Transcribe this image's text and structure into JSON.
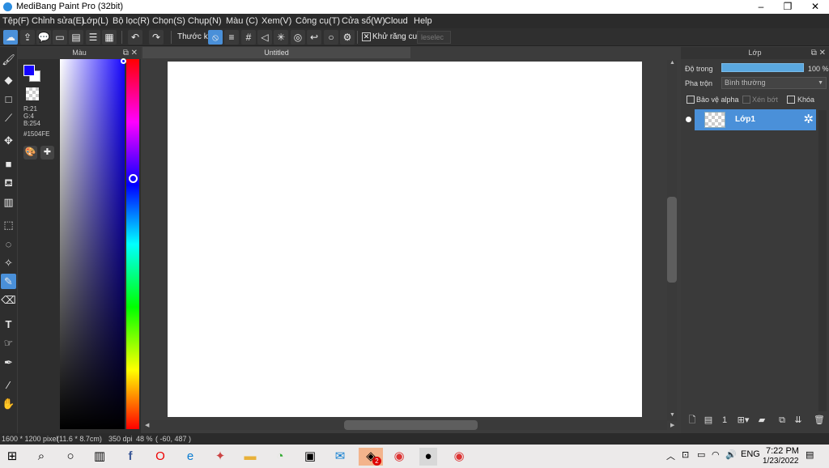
{
  "window": {
    "title": "MediBang Paint Pro (32bit)",
    "controls": [
      "–",
      "❐",
      "✕"
    ]
  },
  "menu": [
    "Tệp(F)",
    "Chỉnh sửa(E)",
    "Lớp(L)",
    "Bộ lọc(R)",
    "Chọn(S)",
    "Chụp(N)",
    "Màu (C)",
    "Xem(V)",
    "Công cụ(T)",
    "Cửa sổ(W)",
    "Cloud",
    "Help"
  ],
  "toolbar": {
    "ruler_label": "Thước kẻ",
    "antialias_label": "Khử răng cưa",
    "antialias_checked": "✕",
    "deselect_label": "leselec"
  },
  "color_panel": {
    "title": "Màu",
    "r": "R:21",
    "g": "G:4",
    "b": "B:254",
    "hex": "#1504FE",
    "foreground": "#1504fe",
    "background": "#ffffff"
  },
  "canvas": {
    "tab_title": "Untitled"
  },
  "layer_panel": {
    "title": "Lớp",
    "opacity_label": "Độ trong",
    "opacity_value": "100 %",
    "opacity": 1.0,
    "blend_label": "Pha trộn",
    "blend_value": "Bình thường",
    "protect_alpha": "Bảo vệ alpha",
    "clipping": "Xén bớt",
    "lock": "Khóa",
    "layers": [
      {
        "name": "Lớp1"
      }
    ]
  },
  "status": {
    "size": "1600 * 1200 pixel",
    "cm": "(11.6 * 8.7cm)",
    "dpi": "350 dpi",
    "zoom": "48 %",
    "coords": "( -60, 487 )"
  },
  "taskbar": {
    "time": "7:22 PM",
    "date": "1/23/2022",
    "lang": "ENG",
    "badge": "2"
  },
  "icons": {
    "tools": [
      "brush-icon",
      "eraser-icon",
      "rectangle-icon",
      "line-icon",
      "move-icon",
      "fill-rect-icon",
      "bucket-icon",
      "gradient-icon",
      "select-rect-icon",
      "lasso-icon",
      "magic-wand-icon",
      "select-pen-icon",
      "select-eraser-icon",
      "text-icon",
      "operation-icon",
      "eyedropper-icon",
      "dropper-icon",
      "hand-icon"
    ]
  }
}
